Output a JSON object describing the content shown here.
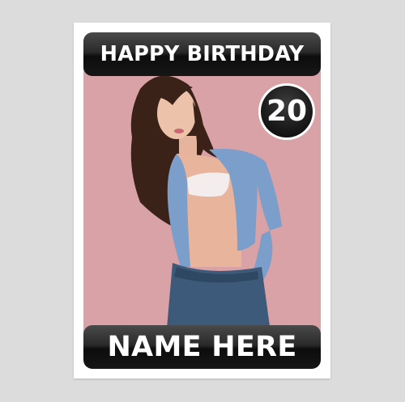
{
  "card": {
    "header_text": "HAPPY BIRTHDAY",
    "age": "20",
    "name_text": "NAME HERE"
  },
  "colors": {
    "background": "#dcdcdc",
    "card": "#ffffff",
    "banner": "#1a1a1a",
    "photo_backdrop": "#d9a2a6"
  }
}
